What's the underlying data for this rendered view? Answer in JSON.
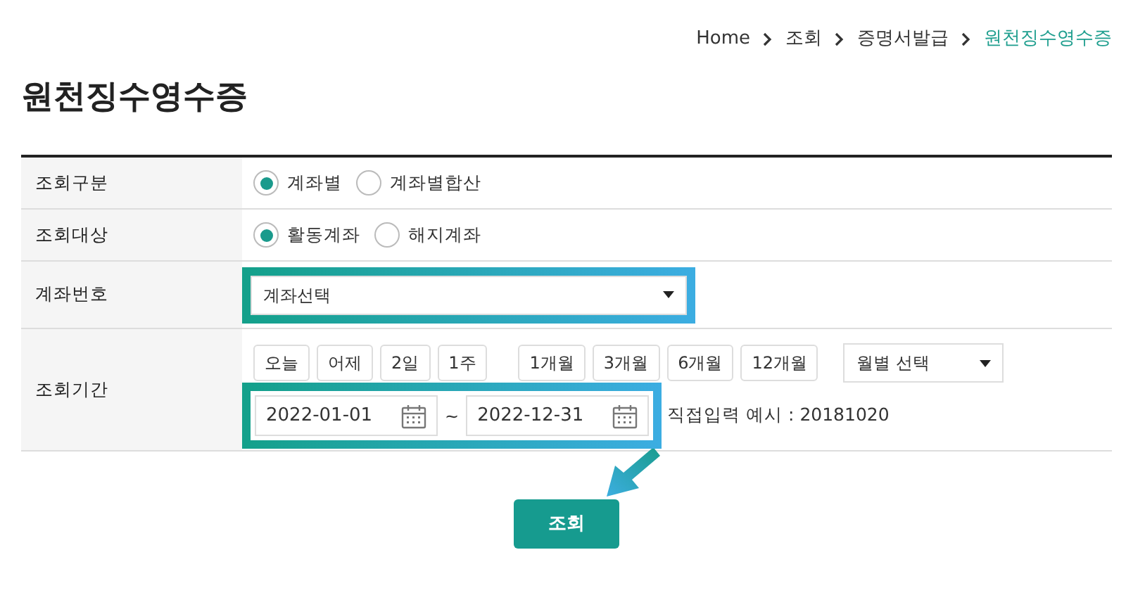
{
  "breadcrumb": [
    {
      "label": "Home",
      "current": false
    },
    {
      "label": "조회",
      "current": false
    },
    {
      "label": "증명서발급",
      "current": false
    },
    {
      "label": "원천징수영수증",
      "current": true
    }
  ],
  "title": "원천징수영수증",
  "rows": [
    {
      "kind": "radio",
      "label": "조회구분",
      "options": [
        {
          "label": "계좌별",
          "selected": true
        },
        {
          "label": "계좌별합산",
          "selected": false
        }
      ]
    },
    {
      "kind": "radio",
      "label": "조회대상",
      "options": [
        {
          "label": "활동계좌",
          "selected": true
        },
        {
          "label": "해지계좌",
          "selected": false
        }
      ]
    },
    {
      "kind": "select",
      "label": "계좌번호",
      "value": "계좌선택",
      "highlighted": true
    },
    {
      "kind": "period",
      "label": "조회기간",
      "quick_button_groups": [
        [
          "오늘",
          "어제",
          "2일",
          "1주"
        ],
        [
          "1개월",
          "3개월",
          "6개월",
          "12개월"
        ]
      ],
      "month_select": "월별 선택",
      "start_date": "2022-01-01",
      "separator": "~",
      "end_date": "2022-12-31",
      "highlighted": true,
      "hint": "직접입력 예시 : 20181020"
    }
  ],
  "search_button": {
    "label": "조회",
    "pointed": true
  }
}
